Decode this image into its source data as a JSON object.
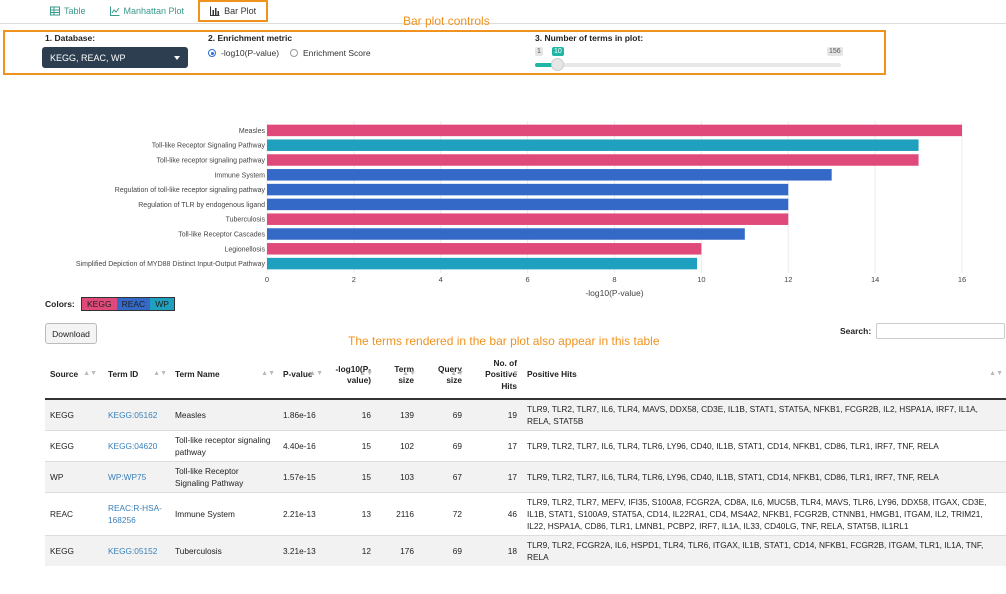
{
  "tabs": [
    {
      "label": "Table",
      "active": false,
      "icon": "table-icon"
    },
    {
      "label": "Manhattan Plot",
      "active": false,
      "icon": "scatter-chart-icon"
    },
    {
      "label": "Bar Plot",
      "active": true,
      "icon": "bar-chart-icon"
    }
  ],
  "annotations": {
    "controls": "Bar plot controls",
    "table": "The terms rendered in the bar plot also appear in this table"
  },
  "controls": {
    "database_label": "1. Database:",
    "database_value": "KEGG, REAC, WP",
    "metric_label": "2. Enrichment metric",
    "metric_options": [
      "-log10(P-value)",
      "Enrichment Score"
    ],
    "metric_selected": "-log10(P-value)",
    "terms_label": "3. Number of terms in plot:",
    "terms_min": "1",
    "terms_value": "10",
    "terms_max": "156",
    "terms_value_numeric": 10,
    "terms_min_numeric": 1,
    "terms_max_numeric": 156
  },
  "colors": {
    "KEGG": "#e04a7a",
    "REAC": "#3569c8",
    "WP": "#1fa0bf",
    "accent": "#f0921e"
  },
  "chart_data": {
    "type": "bar",
    "orientation": "horizontal",
    "categories": [
      "Measles",
      "Toll-like Receptor Signaling Pathway",
      "Toll-like receptor signaling pathway",
      "Immune System",
      "Regulation of toll-like receptor signaling pathway",
      "Regulation of TLR by endogenous ligand",
      "Tuberculosis",
      "Toll-like Receptor Cascades",
      "Legionellosis",
      "Simplified Depiction of MYD88 Distinct Input-Output Pathway"
    ],
    "values": [
      16,
      15,
      15,
      13,
      12,
      12,
      12,
      11,
      10,
      9.9
    ],
    "sources": [
      "KEGG",
      "WP",
      "KEGG",
      "REAC",
      "REAC",
      "REAC",
      "KEGG",
      "REAC",
      "KEGG",
      "WP"
    ],
    "xlabel": "-log10(P-value)",
    "xlim": [
      0,
      16
    ],
    "xticks": [
      0,
      2,
      4,
      6,
      8,
      10,
      12,
      14,
      16
    ],
    "grid": true
  },
  "legend": {
    "label": "Colors:",
    "items": [
      "KEGG",
      "REAC",
      "WP"
    ]
  },
  "download_label": "Download",
  "search_label": "Search:",
  "table": {
    "headers": [
      "Source",
      "Term ID",
      "Term Name",
      "P-value",
      "-log10(P-value)",
      "Term size",
      "Query size",
      "No. of Positive Hits",
      "Positive Hits"
    ],
    "rows": [
      {
        "source": "KEGG",
        "id": "KEGG:05162",
        "name": "Measles",
        "p": "1.86e-16",
        "logp": "16",
        "term_size": "139",
        "query_size": "69",
        "hits_n": "19",
        "hits": "TLR9, TLR2, TLR7, IL6, TLR4, MAVS, DDX58, CD3E, IL1B, STAT1, STAT5A, NFKB1, FCGR2B, IL2, HSPA1A, IRF7, IL1A, RELA, STAT5B"
      },
      {
        "source": "KEGG",
        "id": "KEGG:04620",
        "name": "Toll-like receptor signaling pathway",
        "p": "4.40e-16",
        "logp": "15",
        "term_size": "102",
        "query_size": "69",
        "hits_n": "17",
        "hits": "TLR9, TLR2, TLR7, IL6, TLR4, TLR6, LY96, CD40, IL1B, STAT1, CD14, NFKB1, CD86, TLR1, IRF7, TNF, RELA"
      },
      {
        "source": "WP",
        "id": "WP:WP75",
        "name": "Toll-like Receptor Signaling Pathway",
        "p": "1.57e-15",
        "logp": "15",
        "term_size": "103",
        "query_size": "67",
        "hits_n": "17",
        "hits": "TLR9, TLR2, TLR7, IL6, TLR4, TLR6, LY96, CD40, IL1B, STAT1, CD14, NFKB1, CD86, TLR1, IRF7, TNF, RELA"
      },
      {
        "source": "REAC",
        "id": "REAC:R-HSA-168256",
        "name": "Immune System",
        "p": "2.21e-13",
        "logp": "13",
        "term_size": "2116",
        "query_size": "72",
        "hits_n": "46",
        "hits": "TLR9, TLR2, TLR7, MEFV, IFI35, S100A8, FCGR2A, CD8A, IL6, MUC5B, TLR4, MAVS, TLR6, LY96, DDX58, ITGAX, CD3E, IL1B, STAT1, S100A9, STAT5A, CD14, IL22RA1, CD4, MS4A2, NFKB1, FCGR2B, CTNNB1, HMGB1, ITGAM, IL2, TRIM21, IL22, HSPA1A, CD86, TLR1, LMNB1, PCBP2, IRF7, IL1A, IL33, CD40LG, TNF, RELA, STAT5B, IL1RL1"
      },
      {
        "source": "KEGG",
        "id": "KEGG:05152",
        "name": "Tuberculosis",
        "p": "3.21e-13",
        "logp": "12",
        "term_size": "176",
        "query_size": "69",
        "hits_n": "18",
        "hits": "TLR9, TLR2, FCGR2A, IL6, HSPD1, TLR4, TLR6, ITGAX, IL1B, STAT1, CD14, NFKB1, FCGR2B, ITGAM, TLR1, IL1A, TNF, RELA"
      }
    ]
  }
}
